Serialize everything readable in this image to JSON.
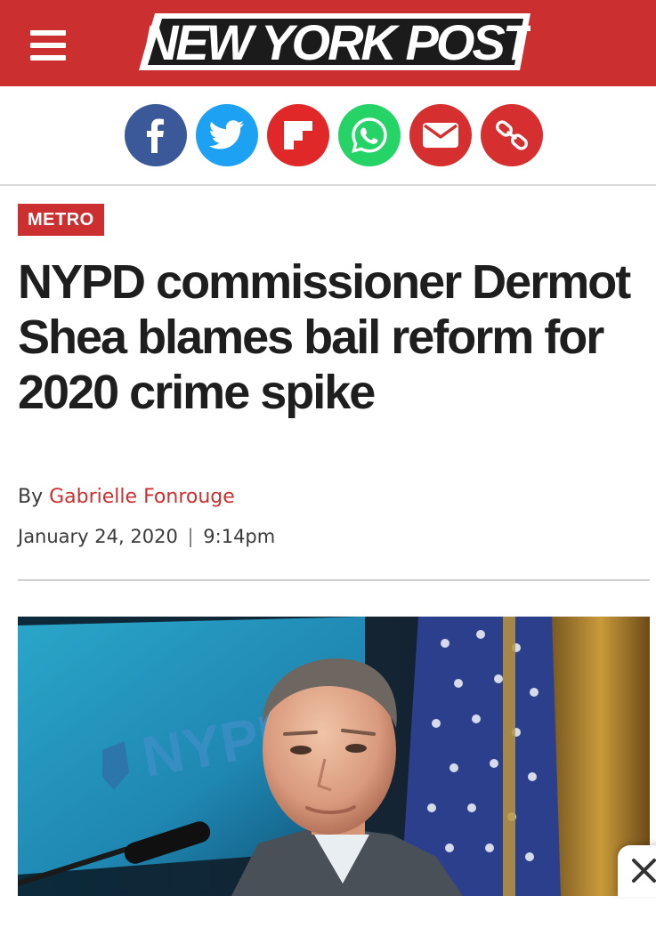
{
  "header": {
    "logo_text": "NEW YORK POST",
    "brand_color": "#cc2f2f"
  },
  "share": {
    "buttons": [
      {
        "name": "facebook",
        "icon": "facebook-icon",
        "color": "#3b5998"
      },
      {
        "name": "twitter",
        "icon": "twitter-icon",
        "color": "#1da1f2"
      },
      {
        "name": "flipboard",
        "icon": "flipboard-icon",
        "color": "#e12828"
      },
      {
        "name": "whatsapp",
        "icon": "whatsapp-icon",
        "color": "#25d366"
      },
      {
        "name": "email",
        "icon": "email-icon",
        "color": "#d62f2f"
      },
      {
        "name": "copy-link",
        "icon": "link-icon",
        "color": "#d62f2f"
      }
    ]
  },
  "article": {
    "category": "METRO",
    "headline": "NYPD commissioner Dermot Shea blames bail reform for 2020 crime spike",
    "byline_prefix": "By",
    "author": "Gabrielle Fonrouge",
    "date": "January 24, 2020",
    "time": "9:14pm",
    "date_separator": "|"
  },
  "photo": {
    "screen_text": "NYPD"
  }
}
